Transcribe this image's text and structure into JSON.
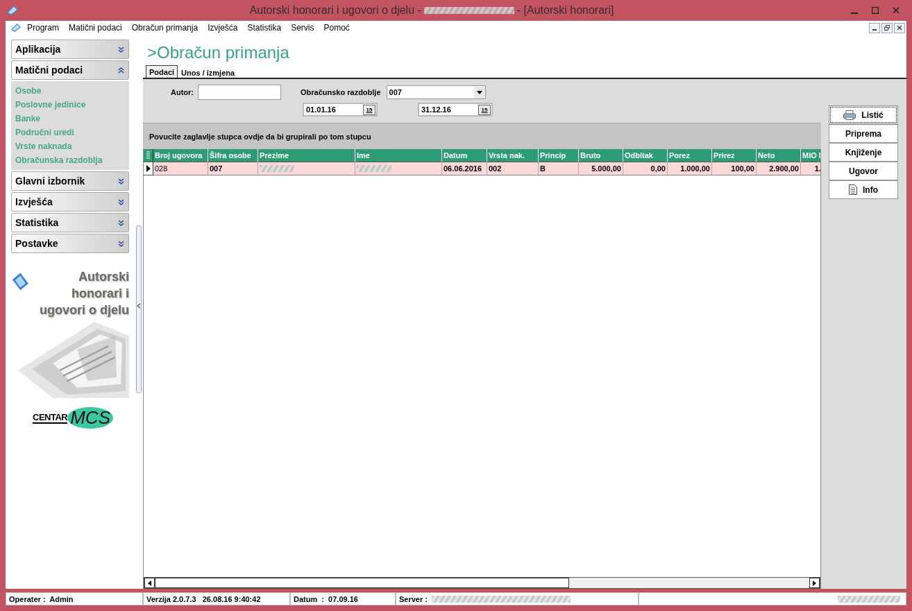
{
  "window": {
    "title_start": "Autorski honorari i ugovori o djelu -",
    "title_end": "- [Autorski honorari]"
  },
  "menu": [
    {
      "label": "Program"
    },
    {
      "label": "Matični podaci"
    },
    {
      "label": "Obračun primanja"
    },
    {
      "label": "Izvješća"
    },
    {
      "label": "Statistika"
    },
    {
      "label": "Servis"
    },
    {
      "label": "Pomoć"
    }
  ],
  "sidebar": {
    "sections": [
      {
        "label": "Aplikacija",
        "expanded": false
      },
      {
        "label": "Matični podaci",
        "expanded": true,
        "items": [
          "Osobe",
          "Poslovne jedinice",
          "Banke",
          "Područni uredi",
          "Vrste naknada",
          "Obračunska razdoblja"
        ]
      },
      {
        "label": "Glavni izbornik",
        "expanded": false
      },
      {
        "label": "Izvješća",
        "expanded": false
      },
      {
        "label": "Statistika",
        "expanded": false
      },
      {
        "label": "Postavke",
        "expanded": false
      }
    ],
    "banner": {
      "title": "Autorski honorari i ugovori o djelu"
    },
    "logo": {
      "word": "CENTAR",
      "mark": "MCS"
    }
  },
  "page": {
    "heading": ">Obračun primanja",
    "tabs": [
      {
        "label": "Podaci",
        "selected": true
      },
      {
        "label": "Unos / izmjena",
        "selected": false
      }
    ],
    "filters": {
      "author_label": "Autor:",
      "period_label": "Obračunsko razdoblje",
      "period_value": "007",
      "date_from": "01.01.16",
      "date_from_calendar": "15",
      "date_to": "31.12.16",
      "date_to_calendar": "15"
    },
    "group_hint": "Povucite zaglavlje stupca ovdje da bi grupirali po tom stupcu",
    "table": {
      "columns": [
        {
          "label": "Broj ugovora"
        },
        {
          "label": "Šifra osobe"
        },
        {
          "label": "Prezime"
        },
        {
          "label": "Ime"
        },
        {
          "label": "Datum"
        },
        {
          "label": "Vrsta nak."
        },
        {
          "label": "Princip"
        },
        {
          "label": "Bruto"
        },
        {
          "label": "Odbitak"
        },
        {
          "label": "Porez"
        },
        {
          "label": "Prirez"
        },
        {
          "label": "Neto"
        },
        {
          "label": "MIO I"
        }
      ],
      "rows": [
        {
          "selected": true,
          "cells": [
            {
              "text": "028",
              "bold": false
            },
            {
              "text": "007",
              "bold": true
            },
            {
              "kind": "blurred"
            },
            {
              "kind": "blurred"
            },
            {
              "text": "06.06.2016",
              "bold": true
            },
            {
              "text": "002",
              "bold": true
            },
            {
              "text": "B",
              "bold": true
            },
            {
              "text": "5.000,00",
              "bold": true
            },
            {
              "text": "0,00",
              "bold": true
            },
            {
              "text": "1.000,00",
              "bold": true
            },
            {
              "text": "100,00",
              "bold": true
            },
            {
              "text": "2.900,00",
              "bold": true
            },
            {
              "text": "1.",
              "bold": true
            }
          ]
        }
      ]
    },
    "actions": [
      {
        "label": "Listić",
        "kind": "printer",
        "focused": true
      },
      {
        "label": "Priprema",
        "kind": "plain",
        "focused": false
      },
      {
        "label": "Knjiženje",
        "kind": "plain",
        "focused": false
      },
      {
        "label": "Ugovor",
        "kind": "plain",
        "focused": false
      },
      {
        "label": "Info",
        "kind": "document",
        "focused": false
      }
    ]
  },
  "status_bar": {
    "operator": "Operater :  Admin",
    "version": "Verzija 2.0.7.3   26.08.16 9:40:42",
    "date": "Datum  :  07.09.16",
    "server": "Server :"
  }
}
